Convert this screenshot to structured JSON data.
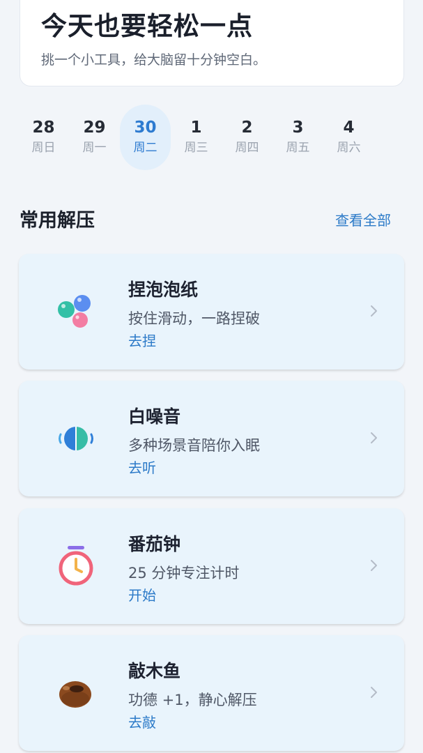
{
  "header": {
    "title": "今天也要轻松一点",
    "subtitle": "挑一个小工具，给大脑留十分钟空白。"
  },
  "calendar": {
    "days": [
      {
        "num": "28",
        "weekday": "周日",
        "active": false
      },
      {
        "num": "29",
        "weekday": "周一",
        "active": false
      },
      {
        "num": "30",
        "weekday": "周二",
        "active": true
      },
      {
        "num": "1",
        "weekday": "周三",
        "active": false
      },
      {
        "num": "2",
        "weekday": "周四",
        "active": false
      },
      {
        "num": "3",
        "weekday": "周五",
        "active": false
      },
      {
        "num": "4",
        "weekday": "周六",
        "active": false
      }
    ]
  },
  "section": {
    "title": "常用解压",
    "view_all": "查看全部"
  },
  "tools": [
    {
      "title": "捏泡泡纸",
      "desc": "按住滑动，一路捏破",
      "action": "去捏",
      "icon": "bubbles-icon"
    },
    {
      "title": "白噪音",
      "desc": "多种场景音陪你入眠",
      "action": "去听",
      "icon": "white-noise-icon"
    },
    {
      "title": "番茄钟",
      "desc": "25 分钟专注计时",
      "action": "开始",
      "icon": "timer-icon"
    },
    {
      "title": "敲木鱼",
      "desc": "功德 +1，静心解压",
      "action": "去敲",
      "icon": "wooden-fish-icon"
    }
  ],
  "colors": {
    "accent": "#2c7ac8",
    "card_bg": "#e9f4fc",
    "page_bg": "#f2f5f9"
  }
}
